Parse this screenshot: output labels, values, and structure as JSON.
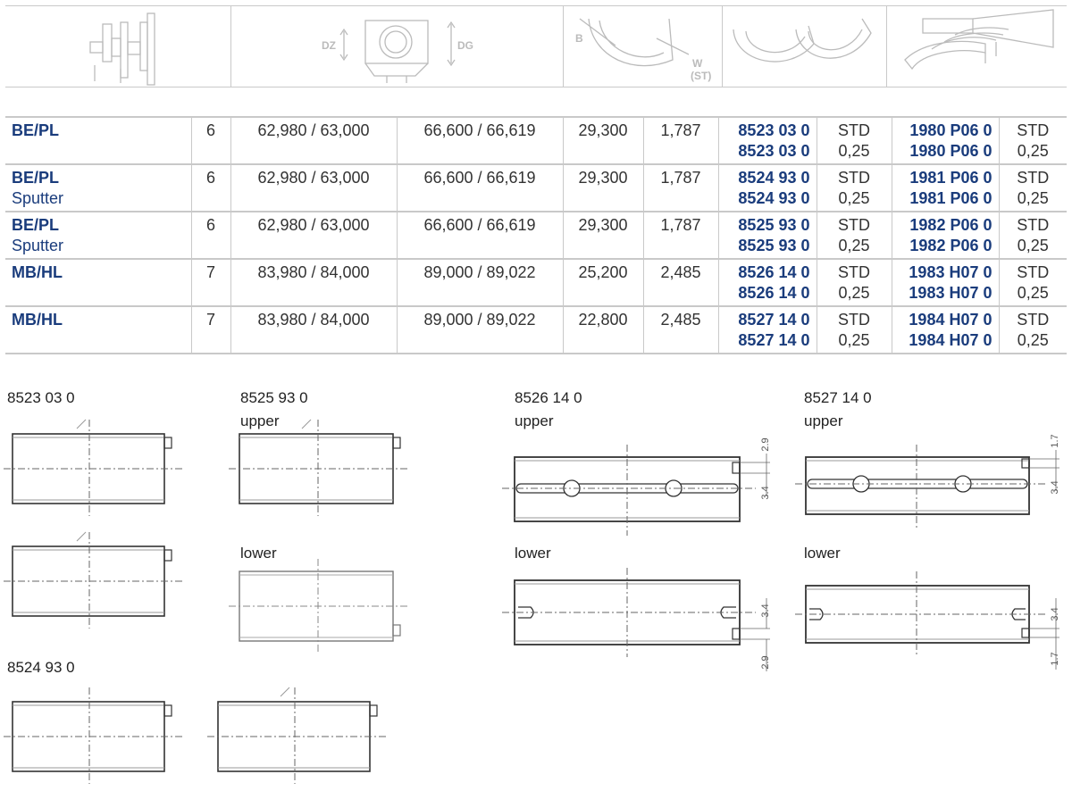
{
  "header": {
    "labels": {
      "dz": "DZ",
      "dg": "DG",
      "b": "B",
      "w": "W",
      "st": "(ST)"
    }
  },
  "rows": [
    {
      "type": "BE/PL",
      "sub": "",
      "count": "6",
      "d1": "62,980 / 63,000",
      "d2": "66,600 / 66,619",
      "width": "29,300",
      "wall": "1,787",
      "part_a": [
        "8523 03 0",
        "8523 03 0"
      ],
      "size_a": [
        "STD",
        "0,25"
      ],
      "part_b": [
        "1980 P06 0",
        "1980 P06 0"
      ],
      "size_b": [
        "STD",
        "0,25"
      ]
    },
    {
      "type": "BE/PL",
      "sub": "Sputter",
      "count": "6",
      "d1": "62,980 / 63,000",
      "d2": "66,600 / 66,619",
      "width": "29,300",
      "wall": "1,787",
      "part_a": [
        "8524 93 0",
        "8524 93 0"
      ],
      "size_a": [
        "STD",
        "0,25"
      ],
      "part_b": [
        "1981 P06 0",
        "1981 P06 0"
      ],
      "size_b": [
        "STD",
        "0,25"
      ]
    },
    {
      "type": "BE/PL",
      "sub": "Sputter",
      "count": "6",
      "d1": "62,980 / 63,000",
      "d2": "66,600 / 66,619",
      "width": "29,300",
      "wall": "1,787",
      "part_a": [
        "8525 93 0",
        "8525 93 0"
      ],
      "size_a": [
        "STD",
        "0,25"
      ],
      "part_b": [
        "1982 P06 0",
        "1982 P06 0"
      ],
      "size_b": [
        "STD",
        "0,25"
      ]
    },
    {
      "type": "MB/HL",
      "sub": "",
      "count": "7",
      "d1": "83,980 / 84,000",
      "d2": "89,000 / 89,022",
      "width": "25,200",
      "wall": "2,485",
      "part_a": [
        "8526 14 0",
        "8526 14 0"
      ],
      "size_a": [
        "STD",
        "0,25"
      ],
      "part_b": [
        "1983 H07 0",
        "1983 H07 0"
      ],
      "size_b": [
        "STD",
        "0,25"
      ]
    },
    {
      "type": "MB/HL",
      "sub": "",
      "count": "7",
      "d1": "83,980 / 84,000",
      "d2": "89,000 / 89,022",
      "width": "22,800",
      "wall": "2,485",
      "part_a": [
        "8527 14 0",
        "8527 14 0"
      ],
      "size_a": [
        "STD",
        "0,25"
      ],
      "part_b": [
        "1984 H07 0",
        "1984 H07 0"
      ],
      "size_b": [
        "STD",
        "0,25"
      ]
    }
  ],
  "drawings": {
    "d8523": {
      "title": "8523 03 0"
    },
    "d8524": {
      "title": "8524 93 0"
    },
    "d8525": {
      "title": "8525 93 0",
      "upper": "upper",
      "lower": "lower"
    },
    "d8526": {
      "title": "8526 14 0",
      "upper": "upper",
      "lower": "lower",
      "dim_a": "2.9",
      "dim_b": "3.4"
    },
    "d8527": {
      "title": "8527 14 0",
      "upper": "upper",
      "lower": "lower",
      "dim_a": "1.7",
      "dim_b": "3.4"
    }
  }
}
